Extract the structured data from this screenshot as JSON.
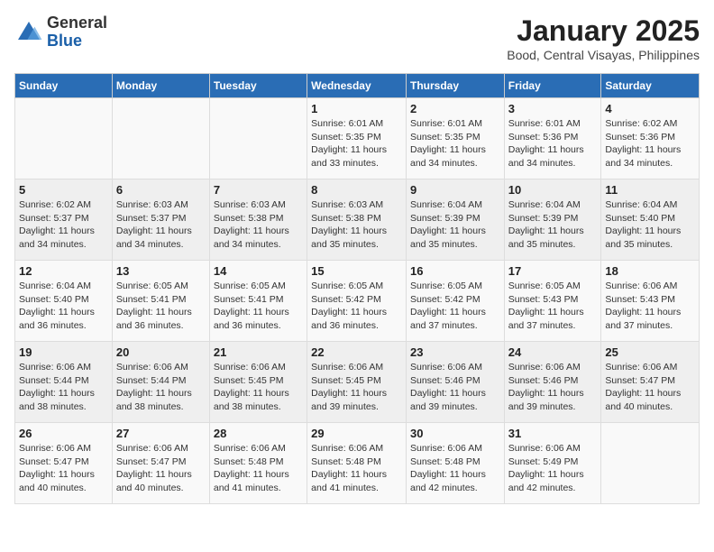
{
  "logo": {
    "general": "General",
    "blue": "Blue"
  },
  "title": "January 2025",
  "subtitle": "Bood, Central Visayas, Philippines",
  "headers": [
    "Sunday",
    "Monday",
    "Tuesday",
    "Wednesday",
    "Thursday",
    "Friday",
    "Saturday"
  ],
  "weeks": [
    [
      {
        "day": "",
        "info": ""
      },
      {
        "day": "",
        "info": ""
      },
      {
        "day": "",
        "info": ""
      },
      {
        "day": "1",
        "info": "Sunrise: 6:01 AM\nSunset: 5:35 PM\nDaylight: 11 hours and 33 minutes."
      },
      {
        "day": "2",
        "info": "Sunrise: 6:01 AM\nSunset: 5:35 PM\nDaylight: 11 hours and 34 minutes."
      },
      {
        "day": "3",
        "info": "Sunrise: 6:01 AM\nSunset: 5:36 PM\nDaylight: 11 hours and 34 minutes."
      },
      {
        "day": "4",
        "info": "Sunrise: 6:02 AM\nSunset: 5:36 PM\nDaylight: 11 hours and 34 minutes."
      }
    ],
    [
      {
        "day": "5",
        "info": "Sunrise: 6:02 AM\nSunset: 5:37 PM\nDaylight: 11 hours and 34 minutes."
      },
      {
        "day": "6",
        "info": "Sunrise: 6:03 AM\nSunset: 5:37 PM\nDaylight: 11 hours and 34 minutes."
      },
      {
        "day": "7",
        "info": "Sunrise: 6:03 AM\nSunset: 5:38 PM\nDaylight: 11 hours and 34 minutes."
      },
      {
        "day": "8",
        "info": "Sunrise: 6:03 AM\nSunset: 5:38 PM\nDaylight: 11 hours and 35 minutes."
      },
      {
        "day": "9",
        "info": "Sunrise: 6:04 AM\nSunset: 5:39 PM\nDaylight: 11 hours and 35 minutes."
      },
      {
        "day": "10",
        "info": "Sunrise: 6:04 AM\nSunset: 5:39 PM\nDaylight: 11 hours and 35 minutes."
      },
      {
        "day": "11",
        "info": "Sunrise: 6:04 AM\nSunset: 5:40 PM\nDaylight: 11 hours and 35 minutes."
      }
    ],
    [
      {
        "day": "12",
        "info": "Sunrise: 6:04 AM\nSunset: 5:40 PM\nDaylight: 11 hours and 36 minutes."
      },
      {
        "day": "13",
        "info": "Sunrise: 6:05 AM\nSunset: 5:41 PM\nDaylight: 11 hours and 36 minutes."
      },
      {
        "day": "14",
        "info": "Sunrise: 6:05 AM\nSunset: 5:41 PM\nDaylight: 11 hours and 36 minutes."
      },
      {
        "day": "15",
        "info": "Sunrise: 6:05 AM\nSunset: 5:42 PM\nDaylight: 11 hours and 36 minutes."
      },
      {
        "day": "16",
        "info": "Sunrise: 6:05 AM\nSunset: 5:42 PM\nDaylight: 11 hours and 37 minutes."
      },
      {
        "day": "17",
        "info": "Sunrise: 6:05 AM\nSunset: 5:43 PM\nDaylight: 11 hours and 37 minutes."
      },
      {
        "day": "18",
        "info": "Sunrise: 6:06 AM\nSunset: 5:43 PM\nDaylight: 11 hours and 37 minutes."
      }
    ],
    [
      {
        "day": "19",
        "info": "Sunrise: 6:06 AM\nSunset: 5:44 PM\nDaylight: 11 hours and 38 minutes."
      },
      {
        "day": "20",
        "info": "Sunrise: 6:06 AM\nSunset: 5:44 PM\nDaylight: 11 hours and 38 minutes."
      },
      {
        "day": "21",
        "info": "Sunrise: 6:06 AM\nSunset: 5:45 PM\nDaylight: 11 hours and 38 minutes."
      },
      {
        "day": "22",
        "info": "Sunrise: 6:06 AM\nSunset: 5:45 PM\nDaylight: 11 hours and 39 minutes."
      },
      {
        "day": "23",
        "info": "Sunrise: 6:06 AM\nSunset: 5:46 PM\nDaylight: 11 hours and 39 minutes."
      },
      {
        "day": "24",
        "info": "Sunrise: 6:06 AM\nSunset: 5:46 PM\nDaylight: 11 hours and 39 minutes."
      },
      {
        "day": "25",
        "info": "Sunrise: 6:06 AM\nSunset: 5:47 PM\nDaylight: 11 hours and 40 minutes."
      }
    ],
    [
      {
        "day": "26",
        "info": "Sunrise: 6:06 AM\nSunset: 5:47 PM\nDaylight: 11 hours and 40 minutes."
      },
      {
        "day": "27",
        "info": "Sunrise: 6:06 AM\nSunset: 5:47 PM\nDaylight: 11 hours and 40 minutes."
      },
      {
        "day": "28",
        "info": "Sunrise: 6:06 AM\nSunset: 5:48 PM\nDaylight: 11 hours and 41 minutes."
      },
      {
        "day": "29",
        "info": "Sunrise: 6:06 AM\nSunset: 5:48 PM\nDaylight: 11 hours and 41 minutes."
      },
      {
        "day": "30",
        "info": "Sunrise: 6:06 AM\nSunset: 5:48 PM\nDaylight: 11 hours and 42 minutes."
      },
      {
        "day": "31",
        "info": "Sunrise: 6:06 AM\nSunset: 5:49 PM\nDaylight: 11 hours and 42 minutes."
      },
      {
        "day": "",
        "info": ""
      }
    ]
  ]
}
